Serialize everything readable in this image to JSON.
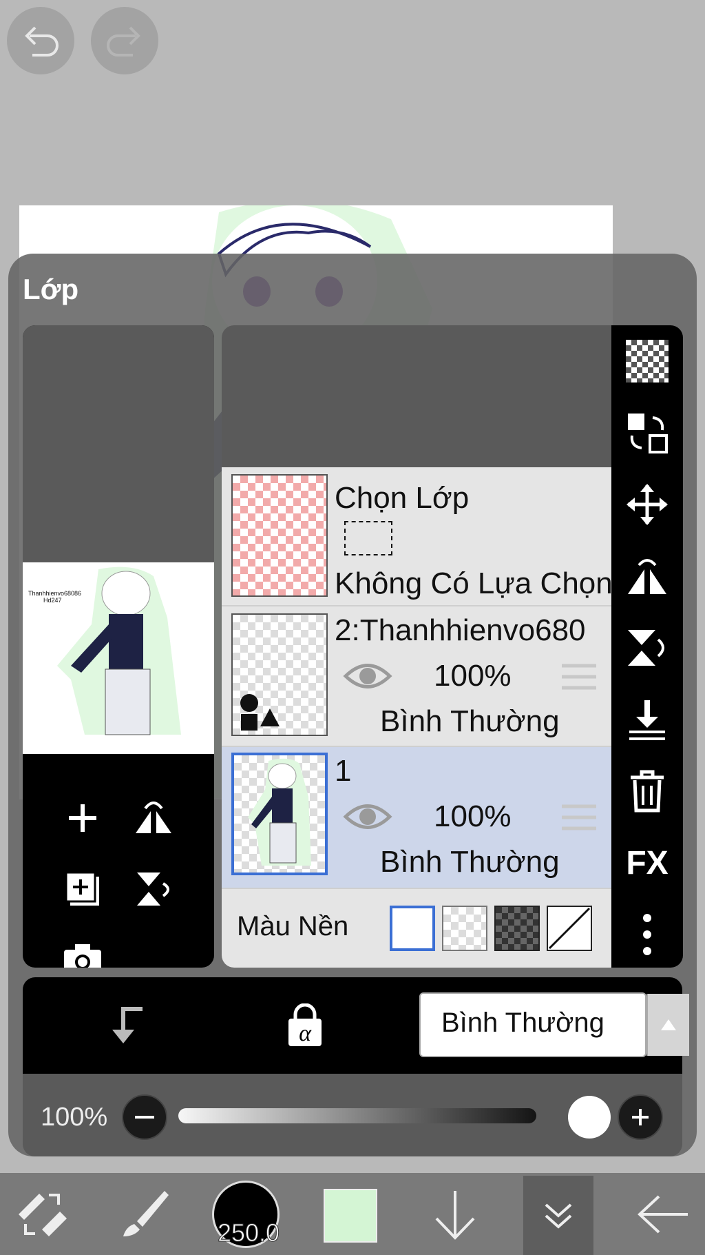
{
  "panel": {
    "title": "Lớp"
  },
  "canvas": {
    "watermark_line1": "Thanhhienvo68086",
    "watermark_line2": "Hd247"
  },
  "layers": [
    {
      "name": "Chọn Lớp",
      "subtitle": "Không Có Lựa Chọn",
      "type": "selection"
    },
    {
      "name": "2:Thanhhienvo680",
      "opacity": "100%",
      "blend": "Bình Thường",
      "visible": true,
      "selected": false
    },
    {
      "name": "1",
      "opacity": "100%",
      "blend": "Bình Thường",
      "visible": true,
      "selected": true
    }
  ],
  "background": {
    "label": "Màu Nền",
    "options": [
      "white",
      "transparent-light",
      "transparent-dark",
      "none"
    ],
    "selected": "white"
  },
  "blend_mode": {
    "value": "Bình Thường"
  },
  "opacity": {
    "label": "100%",
    "value": 100
  },
  "brush": {
    "size": "250.0"
  },
  "colors": {
    "accent": "#3b6fd4",
    "current_color": "#d4f5d4",
    "selected_row": "#cdd6ea"
  },
  "icons": [
    "undo-icon",
    "redo-icon",
    "checker-icon",
    "swap-icon",
    "move-icon",
    "flip-h-icon",
    "flip-v-icon",
    "merge-down-icon",
    "trash-icon",
    "fx-icon",
    "more-icon",
    "add-layer-icon",
    "flip-layer-icon",
    "copy-layer-icon",
    "rotate-layer-icon",
    "camera-icon",
    "clip-icon",
    "alpha-lock-icon"
  ]
}
